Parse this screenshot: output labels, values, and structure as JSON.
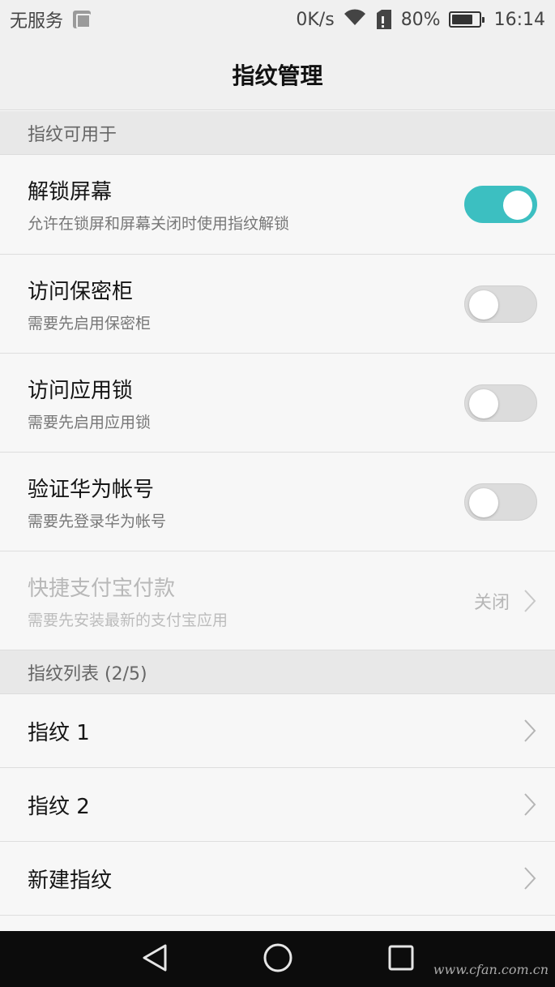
{
  "status_bar": {
    "carrier": "无服务",
    "speed": "0K/s",
    "battery_percent": "80%",
    "battery_level": 0.8,
    "time": "16:14"
  },
  "header": {
    "title": "指纹管理"
  },
  "section_usage": {
    "header": "指纹可用于",
    "items": [
      {
        "title": "解锁屏幕",
        "subtitle": "允许在锁屏和屏幕关闭时使用指纹解锁",
        "toggle_on": true
      },
      {
        "title": "访问保密柜",
        "subtitle": "需要先启用保密柜",
        "toggle_on": false
      },
      {
        "title": "访问应用锁",
        "subtitle": "需要先启用应用锁",
        "toggle_on": false
      },
      {
        "title": "验证华为帐号",
        "subtitle": "需要先登录华为帐号",
        "toggle_on": false
      },
      {
        "title": "快捷支付宝付款",
        "subtitle": "需要先安装最新的支付宝应用",
        "value": "关闭",
        "disabled": true
      }
    ]
  },
  "section_list": {
    "header": "指纹列表 (2/5)",
    "items": [
      {
        "title": "指纹 1"
      },
      {
        "title": "指纹 2"
      },
      {
        "title": "新建指纹"
      }
    ]
  },
  "nav_bar": {
    "buttons": [
      "back-icon",
      "home-icon",
      "recents-icon"
    ]
  },
  "watermark": "www.cfan.com.cn",
  "colors": {
    "accent": "#3cbfc1",
    "nav_background": "#0c0c0c"
  }
}
